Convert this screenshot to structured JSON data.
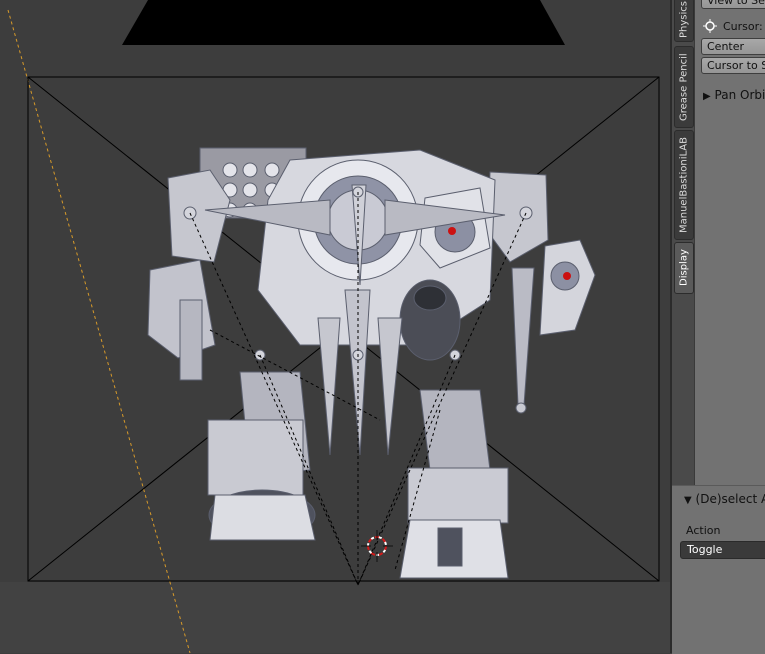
{
  "viewport": {
    "description_icon": "robot-mech-model"
  },
  "tool_tabs": [
    {
      "label": "Physics",
      "active": false
    },
    {
      "label": "Grease Pencil",
      "active": false
    },
    {
      "label": "ManuelBastioniLAB",
      "active": false
    },
    {
      "label": "Display",
      "active": true
    }
  ],
  "view_panel": {
    "view_to_selected_label": "View to Selected",
    "cursor_label": "Cursor:",
    "center_label": "Center",
    "cursor_to_selected_label": "Cursor to Selected",
    "pan_orbit_label": "Pan Orbit"
  },
  "operator_panel": {
    "title": "(De)select All",
    "action_label": "Action",
    "action_value": "Toggle"
  },
  "colors": {
    "viewport_bg": "#3d3d3d",
    "panel_bg": "#727272",
    "cursor_red": "#d11a1a"
  }
}
